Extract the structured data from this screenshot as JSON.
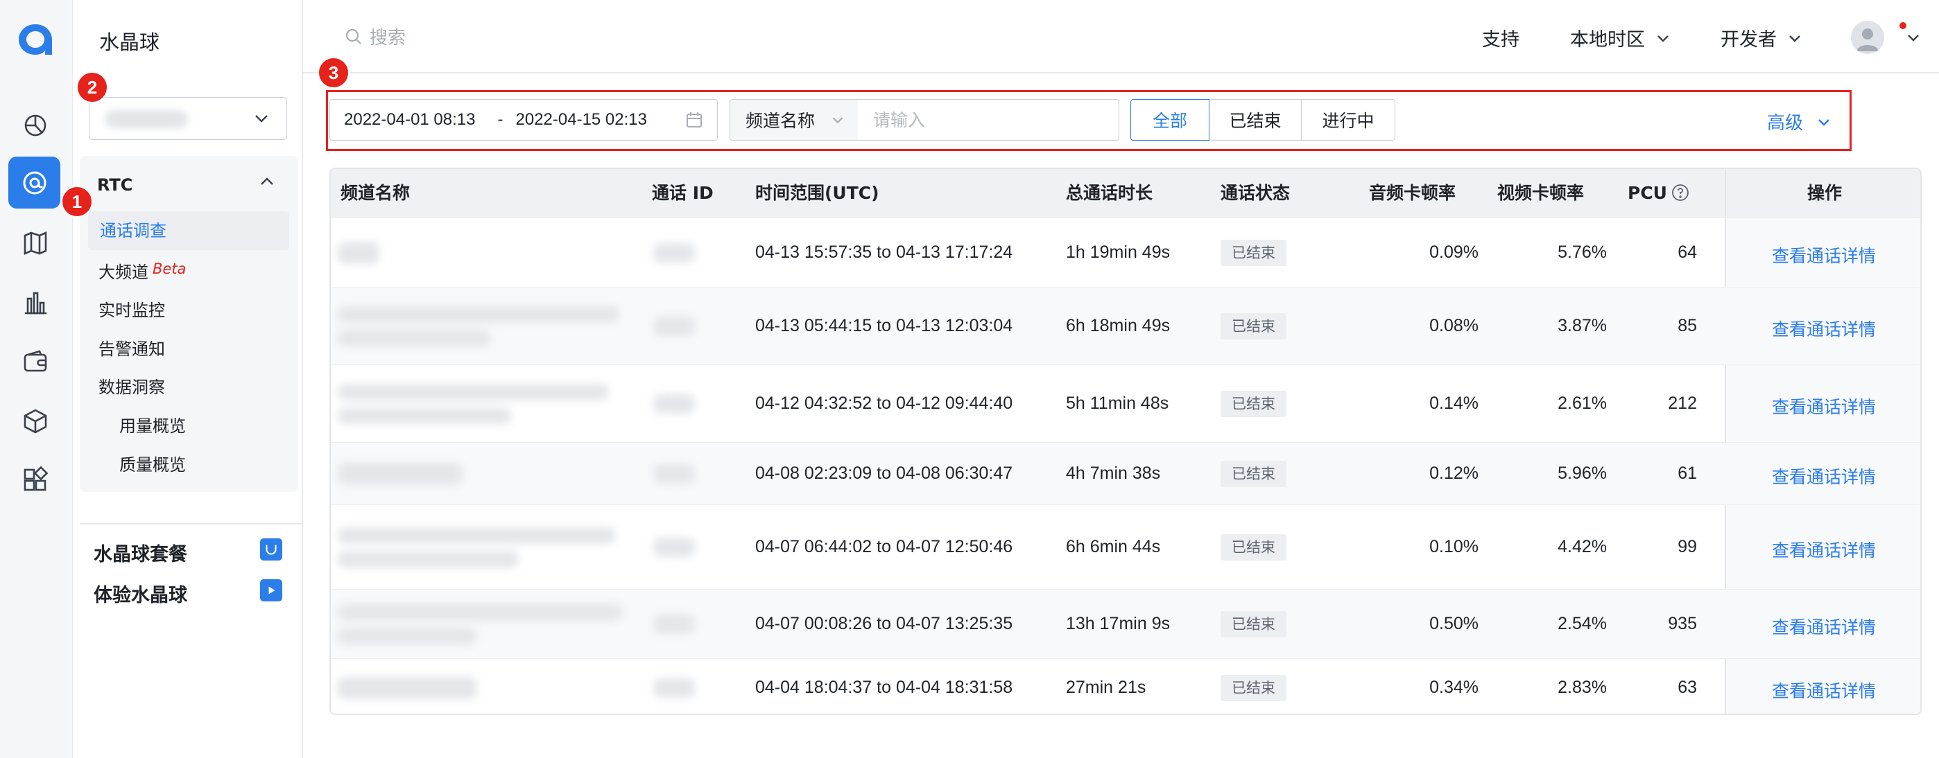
{
  "sidebar": {
    "title": "水晶球",
    "app_select": "",
    "rtc_label": "RTC",
    "menu": [
      {
        "label": "通话调查",
        "active": true
      },
      {
        "label": "大频道",
        "badge": "Beta"
      },
      {
        "label": "实时监控"
      },
      {
        "label": "告警通知"
      },
      {
        "label": "数据洞察"
      }
    ],
    "submenu": [
      "用量概览",
      "质量概览"
    ],
    "links": [
      "水晶球套餐",
      "体验水晶球"
    ]
  },
  "annotations": [
    "1",
    "2",
    "3"
  ],
  "topbar": {
    "search_placeholder": "搜索",
    "support": "支持",
    "timezone": "本地时区",
    "developer": "开发者"
  },
  "filter": {
    "date_start": "2022-04-01 08:13",
    "date_sep": "-",
    "date_end": "2022-04-15 02:13",
    "channel_select": "频道名称",
    "channel_placeholder": "请输入",
    "segments": [
      "全部",
      "已结束",
      "进行中"
    ],
    "selected_segment": "全部",
    "advanced": "高级"
  },
  "table": {
    "headers": {
      "channel": "频道名称",
      "call_id": "通话 ID",
      "time_range": "时间范围(UTC)",
      "duration": "总通话时长",
      "status": "通话状态",
      "audio_freeze": "音频卡顿率",
      "video_freeze": "视频卡顿率",
      "pcu": "PCU",
      "action": "操作"
    },
    "rows": [
      {
        "time_range": "04-13 15:57:35 to 04-13 17:17:24",
        "duration": "1h 19min 49s",
        "status": "已结束",
        "audio": "0.09%",
        "video": "5.76%",
        "pcu": "64",
        "action": "查看通话详情"
      },
      {
        "time_range": "04-13 05:44:15 to 04-13 12:03:04",
        "duration": "6h 18min 49s",
        "status": "已结束",
        "audio": "0.08%",
        "video": "3.87%",
        "pcu": "85",
        "action": "查看通话详情"
      },
      {
        "time_range": "04-12 04:32:52 to 04-12 09:44:40",
        "duration": "5h 11min 48s",
        "status": "已结束",
        "audio": "0.14%",
        "video": "2.61%",
        "pcu": "212",
        "action": "查看通话详情"
      },
      {
        "time_range": "04-08 02:23:09 to 04-08 06:30:47",
        "duration": "4h 7min 38s",
        "status": "已结束",
        "audio": "0.12%",
        "video": "5.96%",
        "pcu": "61",
        "action": "查看通话详情"
      },
      {
        "time_range": "04-07 06:44:02 to 04-07 12:50:46",
        "duration": "6h 6min 44s",
        "status": "已结束",
        "audio": "0.10%",
        "video": "4.42%",
        "pcu": "99",
        "action": "查看通话详情"
      },
      {
        "time_range": "04-07 00:08:26 to 04-07 13:25:35",
        "duration": "13h 17min 9s",
        "status": "已结束",
        "audio": "0.50%",
        "video": "2.54%",
        "pcu": "935",
        "action": "查看通话详情"
      },
      {
        "time_range": "04-04 18:04:37 to 04-04 18:31:58",
        "duration": "27min 21s",
        "status": "已结束",
        "audio": "0.34%",
        "video": "2.83%",
        "pcu": "63",
        "action": "查看通话详情"
      }
    ]
  },
  "colors": {
    "accent": "#2b7de9",
    "annotation": "#e5231b"
  }
}
